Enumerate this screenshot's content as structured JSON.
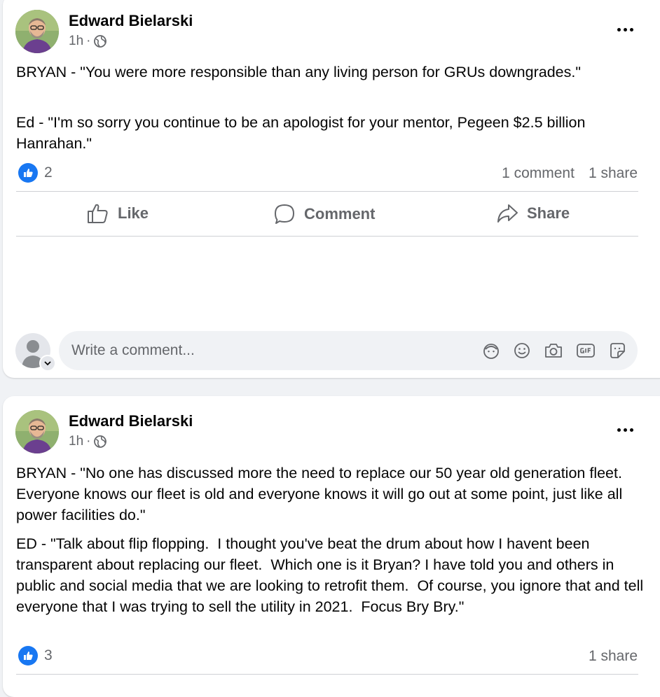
{
  "posts": [
    {
      "author": "Edward Bielarski",
      "time": "1h",
      "separator": "·",
      "paragraphs": [
        "BRYAN - \"You were more responsible than any living person for GRUs downgrades.\"",
        "Ed - \"I'm so sorry you continue to be an apologist for your mentor, Pegeen $2.5 billion Hanrahan.\""
      ],
      "reaction_count": "2",
      "comments_text": "1 comment",
      "shares_text": "1 share",
      "actions": {
        "like": "Like",
        "comment": "Comment",
        "share": "Share"
      },
      "comment_placeholder": "Write a comment..."
    },
    {
      "author": "Edward Bielarski",
      "time": "1h",
      "separator": "·",
      "paragraphs": [
        "BRYAN - \"No one has discussed more the need to replace our 50 year old generation fleet.  Everyone knows our fleet is old and everyone knows it will go out at some point, just like all power facilities do.\"",
        "ED - \"Talk about flip flopping.  I thought you've beat the drum about how I havent been transparent about replacing our fleet.  Which one is it Bryan? I have told you and others in public and social media that we are looking to retrofit them.  Of course, you ignore that and tell everyone that I was trying to sell the utility in 2021.  Focus Bry Bry.\""
      ],
      "reaction_count": "3",
      "shares_text": "1 share"
    }
  ],
  "icons": {
    "privacy": "globe-icon",
    "more": "more-horizontal-icon",
    "reaction": "like-reaction-icon",
    "like": "thumbs-up-icon",
    "comment": "speech-bubble-icon",
    "share": "share-arrow-icon",
    "comment_tools": [
      "avatar-sticker-icon",
      "emoji-icon",
      "camera-icon",
      "gif-icon",
      "sticker-icon"
    ]
  },
  "colors": {
    "accent": "#1877f2",
    "secondary_text": "#65676b",
    "background": "#f0f2f5"
  }
}
